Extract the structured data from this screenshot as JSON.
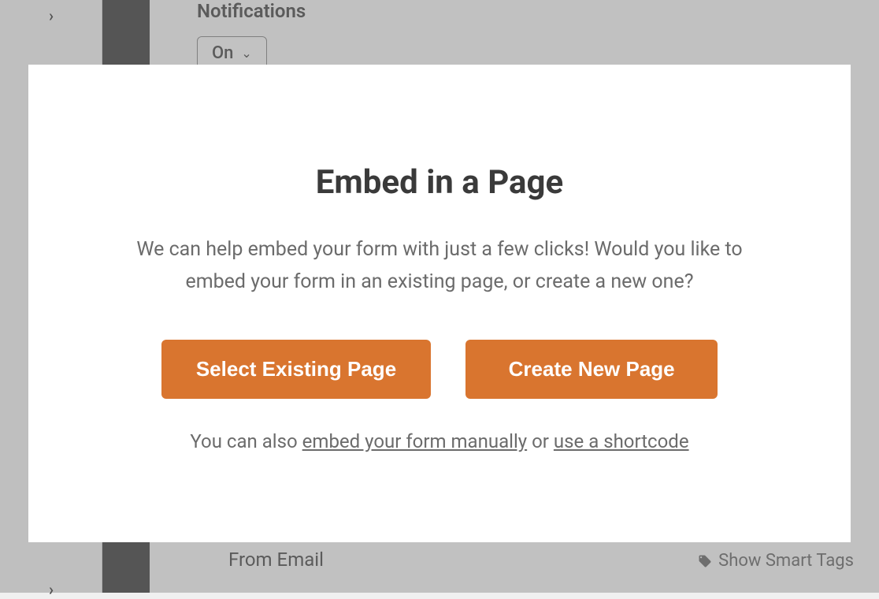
{
  "background": {
    "notifications_label": "Notifications",
    "on_dropdown_value": "On",
    "from_email_label": "From Email",
    "smart_tags_label": "Show Smart Tags"
  },
  "modal": {
    "title": "Embed in a Page",
    "subtitle": "We can help embed your form with just a few clicks! Would you like to embed your form in an existing page, or create a new one?",
    "select_existing_button": "Select Existing Page",
    "create_new_button": "Create New Page",
    "footer_prefix": "You can also ",
    "footer_link_manual": "embed your form manually",
    "footer_middle": " or ",
    "footer_link_shortcode": "use a shortcode"
  }
}
